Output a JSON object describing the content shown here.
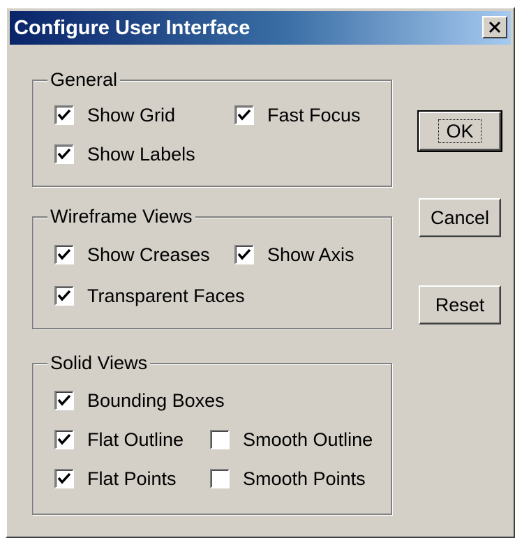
{
  "window": {
    "title": "Configure User Interface",
    "close_icon": "close-icon"
  },
  "groups": {
    "general": {
      "label": "General",
      "show_grid": {
        "label": "Show Grid",
        "checked": true
      },
      "fast_focus": {
        "label": "Fast Focus",
        "checked": true
      },
      "show_labels": {
        "label": "Show Labels",
        "checked": true
      }
    },
    "wireframe": {
      "label": "Wireframe Views",
      "show_creases": {
        "label": "Show Creases",
        "checked": true
      },
      "show_axis": {
        "label": "Show Axis",
        "checked": true
      },
      "transparent_faces": {
        "label": "Transparent Faces",
        "checked": true
      }
    },
    "solid": {
      "label": "Solid Views",
      "bounding_boxes": {
        "label": "Bounding Boxes",
        "checked": true
      },
      "flat_outline": {
        "label": "Flat Outline",
        "checked": true
      },
      "smooth_outline": {
        "label": "Smooth Outline",
        "checked": false
      },
      "flat_points": {
        "label": "Flat Points",
        "checked": true
      },
      "smooth_points": {
        "label": "Smooth Points",
        "checked": false
      }
    }
  },
  "buttons": {
    "ok": "OK",
    "cancel": "Cancel",
    "reset": "Reset"
  },
  "colors": {
    "title_gradient_start": "#0a246a",
    "title_gradient_end": "#a6caf0",
    "dialog_face": "#d4d0c8"
  }
}
